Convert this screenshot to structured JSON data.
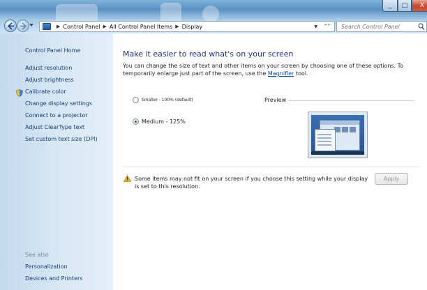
{
  "window": {
    "title_controls": {
      "minimize": "_",
      "maximize": "□",
      "close": "X"
    }
  },
  "address_bar": {
    "crumbs": [
      "Control Panel",
      "All Control Panel Items",
      "Display"
    ],
    "separator": "▶",
    "dropdown_glyph": "▼",
    "refresh_glyph": "⁺⁺"
  },
  "search": {
    "placeholder": "Search Control Panel"
  },
  "sidebar": {
    "home": "Control Panel Home",
    "links": [
      "Adjust resolution",
      "Adjust brightness",
      "Calibrate color",
      "Change display settings",
      "Connect to a projector",
      "Adjust ClearType text",
      "Set custom text size (DPI)"
    ],
    "see_also_title": "See also",
    "see_also": [
      "Personalization",
      "Devices and Printers"
    ]
  },
  "main": {
    "heading": "Make it easier to read what's on your screen",
    "description_pre": "You can change the size of text and other items on your screen by choosing one of these options. To temporarily enlarge just part of the screen, use the ",
    "description_link": "Magnifier",
    "description_post": " tool.",
    "options": [
      {
        "label": "Smaller - 100% (default)",
        "checked": false
      },
      {
        "label": "Medium - 125%",
        "checked": true
      }
    ],
    "preview_label": "Preview",
    "warning": "Some items may not fit on your screen if you choose this setting while your display is set to this resolution.",
    "apply_label": "Apply"
  },
  "colors": {
    "heading": "#1e3287",
    "link": "#163d73",
    "sidebar_bg": "#d9e8f5",
    "close_button": "#c7452e"
  }
}
